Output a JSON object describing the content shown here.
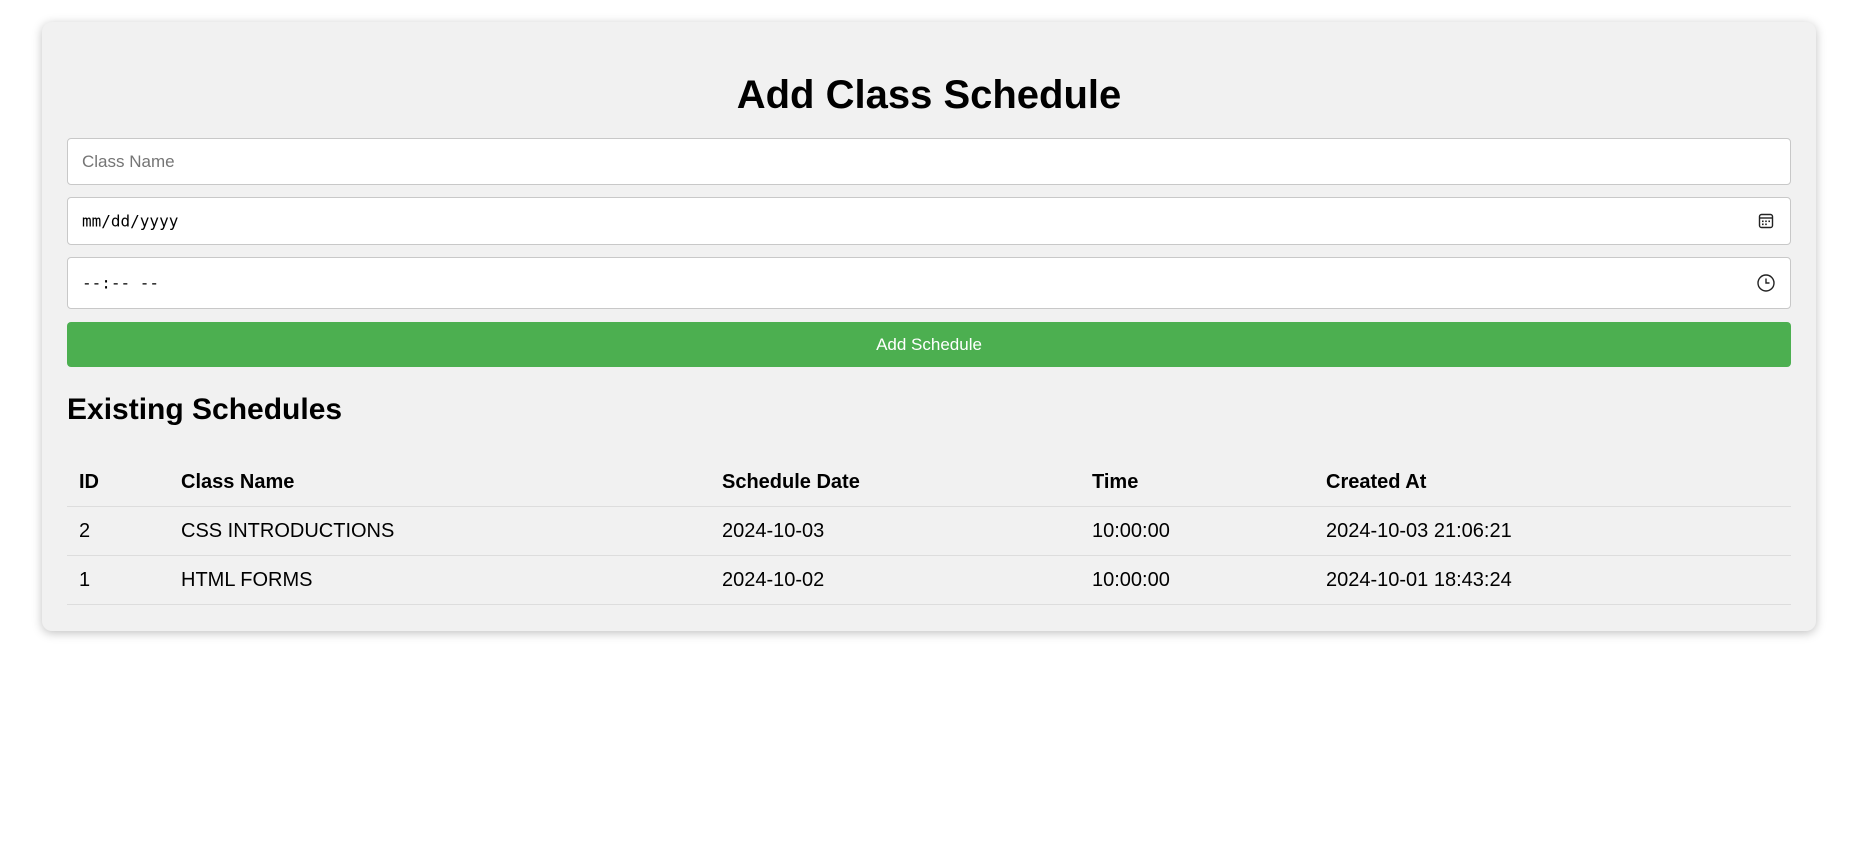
{
  "page": {
    "title": "Add Class Schedule"
  },
  "form": {
    "class_name_placeholder": "Class Name",
    "class_name_value": "",
    "date_placeholder": "mm/dd/yyyy",
    "time_placeholder": "--:-- --",
    "submit_label": "Add Schedule",
    "calendar_icon": "calendar-icon",
    "clock_icon": "clock-icon"
  },
  "schedules": {
    "heading": "Existing Schedules",
    "columns": [
      "ID",
      "Class Name",
      "Schedule Date",
      "Time",
      "Created At"
    ],
    "rows": [
      [
        "2",
        "CSS INTRODUCTIONS",
        "2024-10-03",
        "10:00:00",
        "2024-10-03 21:06:21"
      ],
      [
        "1",
        "HTML FORMS",
        "2024-10-02",
        "10:00:00",
        "2024-10-01 18:43:24"
      ]
    ]
  },
  "colors": {
    "accent": "#4caf50",
    "card_background": "#f1f1f1"
  }
}
